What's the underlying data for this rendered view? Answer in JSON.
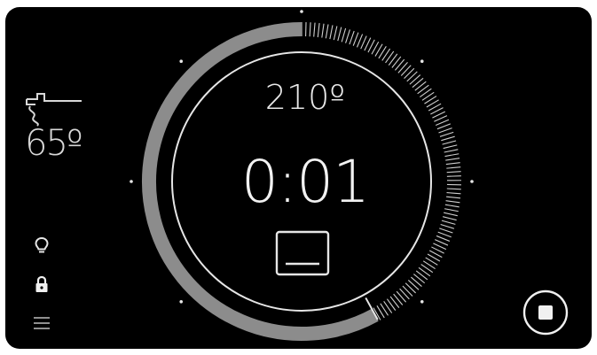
{
  "probe": {
    "icon": "meat-probe-icon",
    "temperature": "65º"
  },
  "oven": {
    "target_temperature": "210º",
    "timer": "0:01",
    "mode_icon": "bottom-heat-icon",
    "progress_fraction": 0.58
  },
  "sidebar": {
    "light_icon": "lightbulb-icon",
    "lock_icon": "lock-icon",
    "menu_icon": "menu-icon"
  },
  "controls": {
    "stop_icon": "stop-icon"
  },
  "colors": {
    "background": "#000000",
    "foreground": "#e8e8e8",
    "progress_track": "#8c8c8c",
    "ticks": "#cfcfcf"
  }
}
